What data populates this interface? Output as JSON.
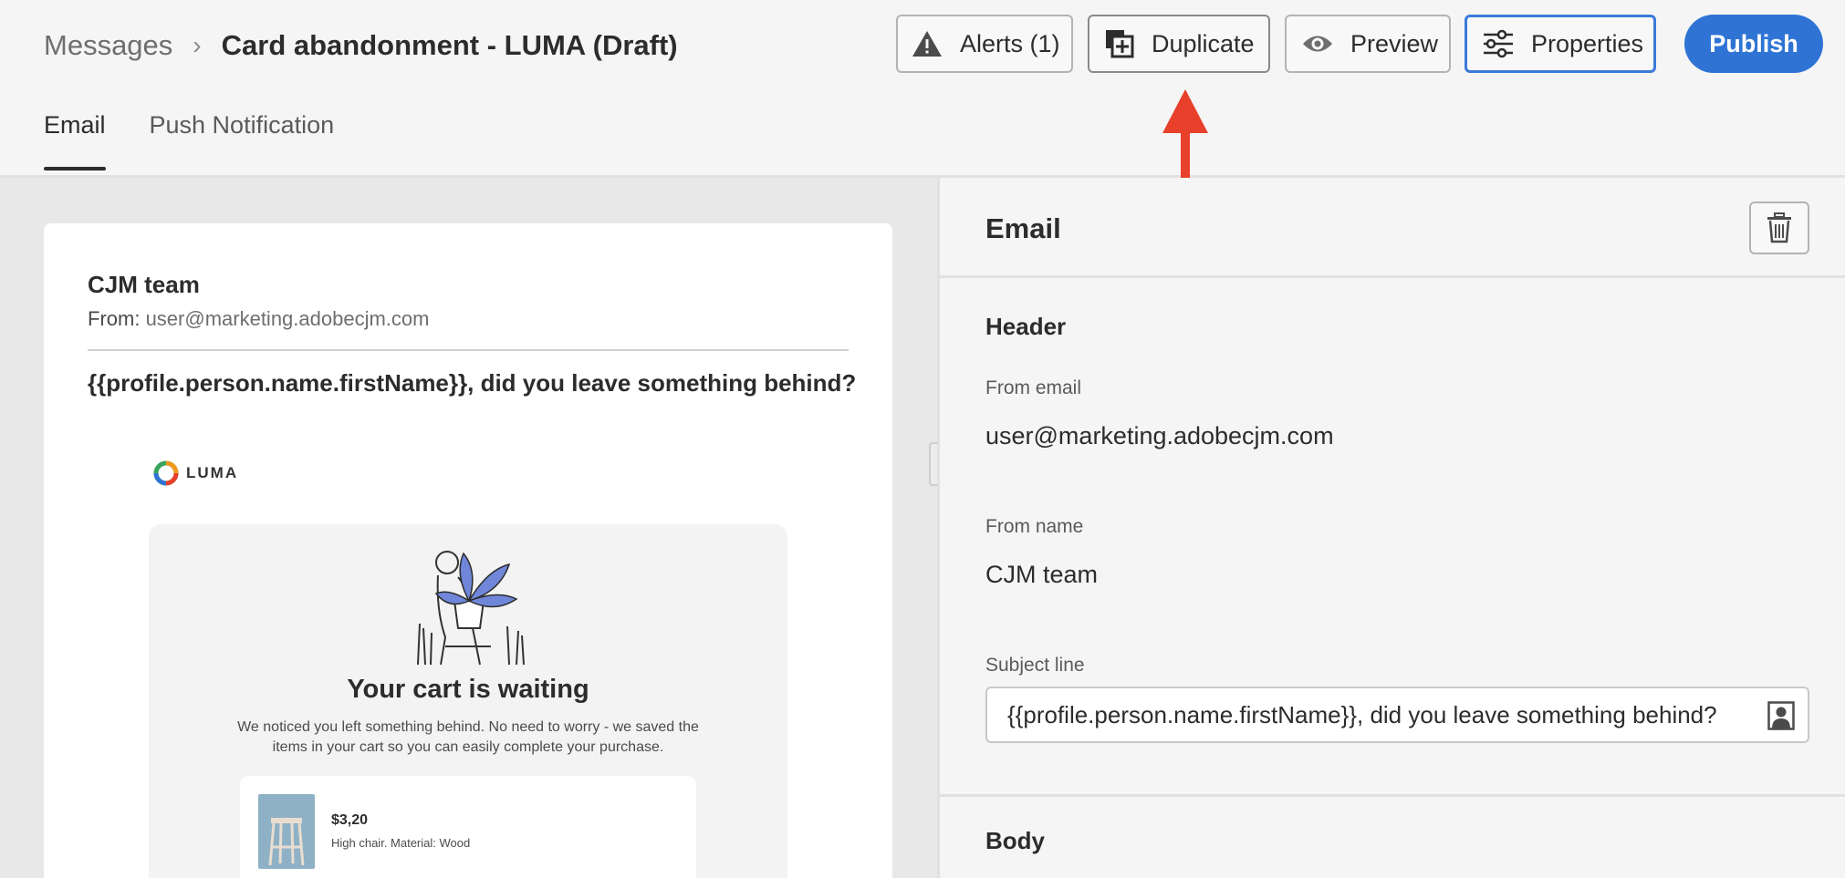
{
  "header": {
    "breadcrumb_parent": "Messages",
    "breadcrumb_sep": "›",
    "breadcrumb_current": "Card abandonment - LUMA (Draft)"
  },
  "toolbar": {
    "alerts_label": "Alerts (1)",
    "duplicate_label": "Duplicate",
    "preview_label": "Preview",
    "properties_label": "Properties",
    "publish_label": "Publish"
  },
  "tabs": [
    {
      "label": "Email",
      "active": true
    },
    {
      "label": "Push Notification",
      "active": false
    }
  ],
  "email_preview": {
    "sender_name": "CJM team",
    "from_prefix": "From: ",
    "from_address": "user@marketing.adobecjm.com",
    "subject": "{{profile.person.name.firstName}}, did you leave something behind?",
    "logo_text": "LUMA",
    "promo_title": "Your cart is waiting",
    "promo_text": "We noticed you left something behind. No need to worry - we saved the items in your cart so you can easily complete your purchase.",
    "product_price": "$3,20",
    "product_desc": "High chair. Material: Wood"
  },
  "panel": {
    "title": "Email",
    "header_section": "Header",
    "from_email_label": "From email",
    "from_email_value": "user@marketing.adobecjm.com",
    "from_name_label": "From name",
    "from_name_value": "CJM team",
    "subject_label": "Subject line",
    "subject_value": "{{profile.person.name.firstName}}, did you leave something behind?",
    "body_section": "Body"
  },
  "colors": {
    "accent": "#2f74d4",
    "annotation_arrow": "#e8402a"
  }
}
